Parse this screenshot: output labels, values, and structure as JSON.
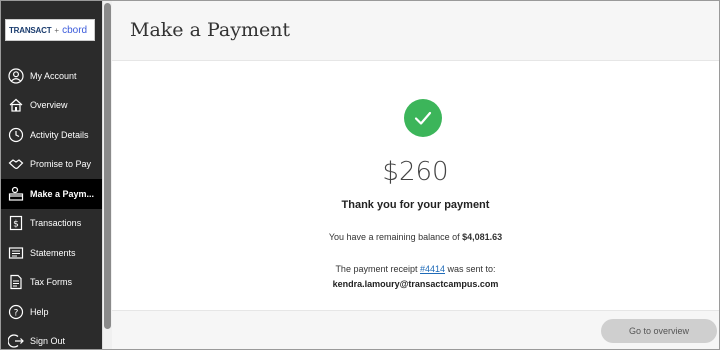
{
  "logo": {
    "brand1": "TRANSACT",
    "plus": "+",
    "brand2": "cbord"
  },
  "nav": {
    "items": [
      {
        "label": "My Account",
        "icon": "user-icon"
      },
      {
        "label": "Overview",
        "icon": "home-icon"
      },
      {
        "label": "Activity Details",
        "icon": "clock-icon"
      },
      {
        "label": "Promise to Pay",
        "icon": "handshake-icon"
      },
      {
        "label": "Make a Paym...",
        "icon": "payment-icon",
        "active": true
      },
      {
        "label": "Transactions",
        "icon": "transactions-icon"
      },
      {
        "label": "Statements",
        "icon": "statements-icon"
      },
      {
        "label": "Tax Forms",
        "icon": "tax-forms-icon"
      },
      {
        "label": "Help",
        "icon": "help-icon"
      },
      {
        "label": "Sign Out",
        "icon": "sign-out-icon"
      }
    ]
  },
  "header": {
    "title": "Make a Payment"
  },
  "confirmation": {
    "amount": "$260",
    "thanks": "Thank you for your payment",
    "balance_prefix": "You have a remaining balance of ",
    "balance_value": "$4,081.63",
    "receipt_prefix": "The payment receipt ",
    "receipt_number": "#4414",
    "receipt_suffix": " was sent to:",
    "email": "kendra.lamoury@transactcampus.com"
  },
  "footer": {
    "button_label": "Go to overview"
  },
  "colors": {
    "sidebar": "#2b2b2b",
    "active": "#000000",
    "success": "#3cb55a",
    "link": "#1f6bb8"
  }
}
